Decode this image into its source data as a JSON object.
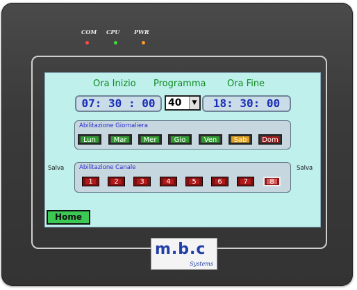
{
  "leds": [
    {
      "label": "COM",
      "color": "#ff4a4a"
    },
    {
      "label": "CPU",
      "color": "#3ddc3d"
    },
    {
      "label": "PWR",
      "color": "#ff9a2a"
    }
  ],
  "header": {
    "start_label": "Ora Inizio",
    "program_label": "Programma",
    "end_label": "Ora Fine"
  },
  "times": {
    "start": "07: 30 : 00",
    "end": "18: 30: 00",
    "program_value": "40"
  },
  "daily": {
    "title": "Abilitazione Giornaliera",
    "days": [
      {
        "label": "Lun",
        "state": "on"
      },
      {
        "label": "Mar",
        "state": "on"
      },
      {
        "label": "Mer",
        "state": "on"
      },
      {
        "label": "Gio",
        "state": "on"
      },
      {
        "label": "Ven",
        "state": "on"
      },
      {
        "label": "Sab",
        "state": "orange"
      },
      {
        "label": "Dom",
        "state": "off"
      }
    ]
  },
  "channel": {
    "title": "Abilitazione Canale",
    "channels": [
      "1",
      "2",
      "3",
      "4",
      "5",
      "6",
      "7",
      "8"
    ]
  },
  "save_left": "Salva",
  "save_right": "Salva",
  "home_label": "Home",
  "logo": {
    "mark": "m.b.c",
    "sub": "Systems"
  },
  "colors": {
    "screen_bg": "#bff0ec",
    "day_on": "#2f9a2f",
    "day_off": "#9a1a1a",
    "day_orange": "#e0a020",
    "channel": "#b21a1a",
    "header_text": "#0e8a1f",
    "time_text": "#1b2fb5"
  }
}
